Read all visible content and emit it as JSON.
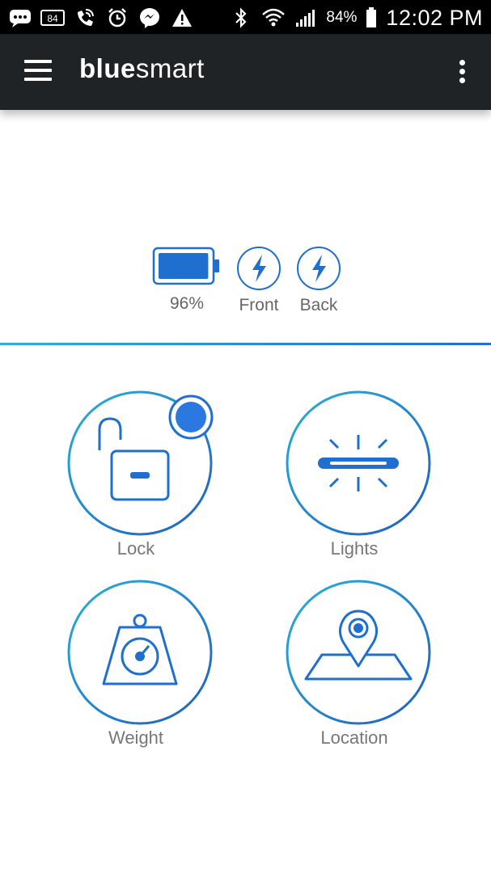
{
  "status_bar": {
    "battery_percent": "84%",
    "time": "12:02 PM"
  },
  "app_bar": {
    "brand_bold": "blue",
    "brand_light": "smart"
  },
  "status": {
    "battery_label": "96%",
    "battery_level": 0.96,
    "front_label": "Front",
    "back_label": "Back"
  },
  "tiles": {
    "lock": {
      "label": "Lock"
    },
    "lights": {
      "label": "Lights"
    },
    "weight": {
      "label": "Weight"
    },
    "location": {
      "label": "Location"
    }
  },
  "colors": {
    "accent": "#1f6fd0",
    "accent_light": "#2bb0d6",
    "appbar": "#202325"
  }
}
